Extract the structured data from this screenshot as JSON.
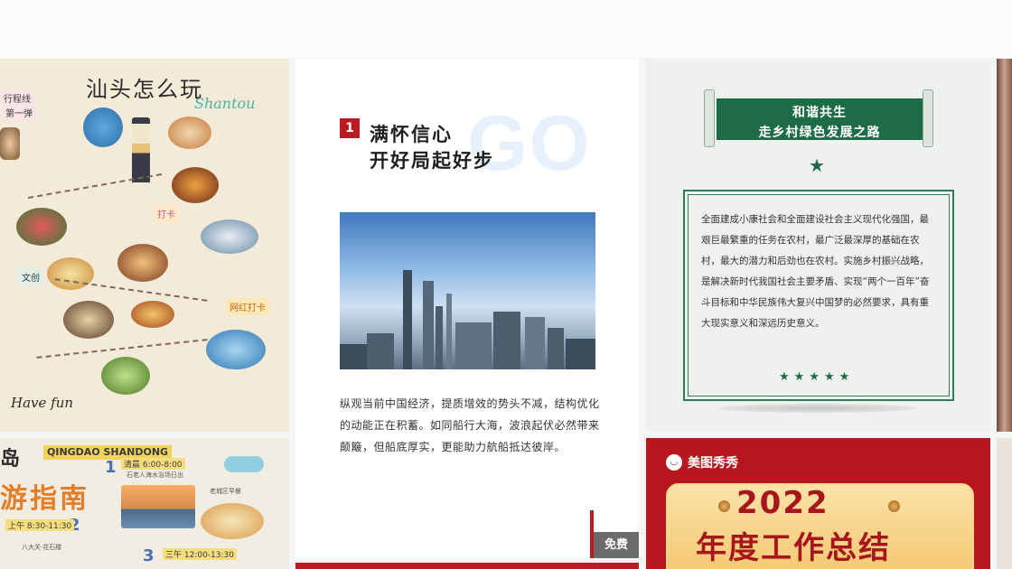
{
  "cards": {
    "shantou": {
      "title": "汕头怎么玩",
      "subtitle": "Shantou",
      "footer": "Have fun",
      "tags": [
        "行程线",
        "第一弹",
        "打卡",
        "文创",
        "网红打卡"
      ],
      "colors": {
        "accent": "#46b3a8",
        "paper": "#f4ead8"
      }
    },
    "qingdao": {
      "en_title": "QINGDAO SHANDONG",
      "big_title": "游指南",
      "prefix": "岛",
      "steps": [
        "1",
        "2",
        "3"
      ],
      "times": [
        "清晨 6:00-8:00",
        "上午 8:30-11:30",
        "三午 12:00-13:30"
      ],
      "notes": [
        "石老人海水浴场日出",
        "老城区早餐",
        "八大关·花石楼"
      ]
    },
    "confidence": {
      "number": "1",
      "bg_word": "GO",
      "heading_line1": "满怀信心",
      "heading_line2": "开好局起好步",
      "paragraph": "纵观当前中国经济，提质增效的势头不减，结构优化的动能正在积蓄。如同船行大海，波浪起伏必然带来颠簸，但船底厚实，更能助力航船抵达彼岸。",
      "badge": "免费"
    },
    "rural": {
      "banner_line1": "和谐共生",
      "banner_line2": "走乡村绿色发展之路",
      "body": "全面建成小康社会和全面建设社会主义现代化强国，最艰巨最繁重的任务在农村，最广泛最深厚的基础在农村，最大的潜力和后劲也在农村。实施乡村振兴战略，是解决新时代我国社会主要矛盾、实现“两个一百年”奋斗目标和中华民族伟大复兴中国梦的必然要求，具有重大现实意义和深远历史意义。",
      "stars": "★★★★★",
      "colors": {
        "green": "#1d6b47"
      }
    },
    "meitu": {
      "brand": "美图秀秀",
      "year": "2022",
      "title": "年度工作总结",
      "colors": {
        "red": "#b8161f",
        "gold": "#f3c56c"
      }
    }
  }
}
